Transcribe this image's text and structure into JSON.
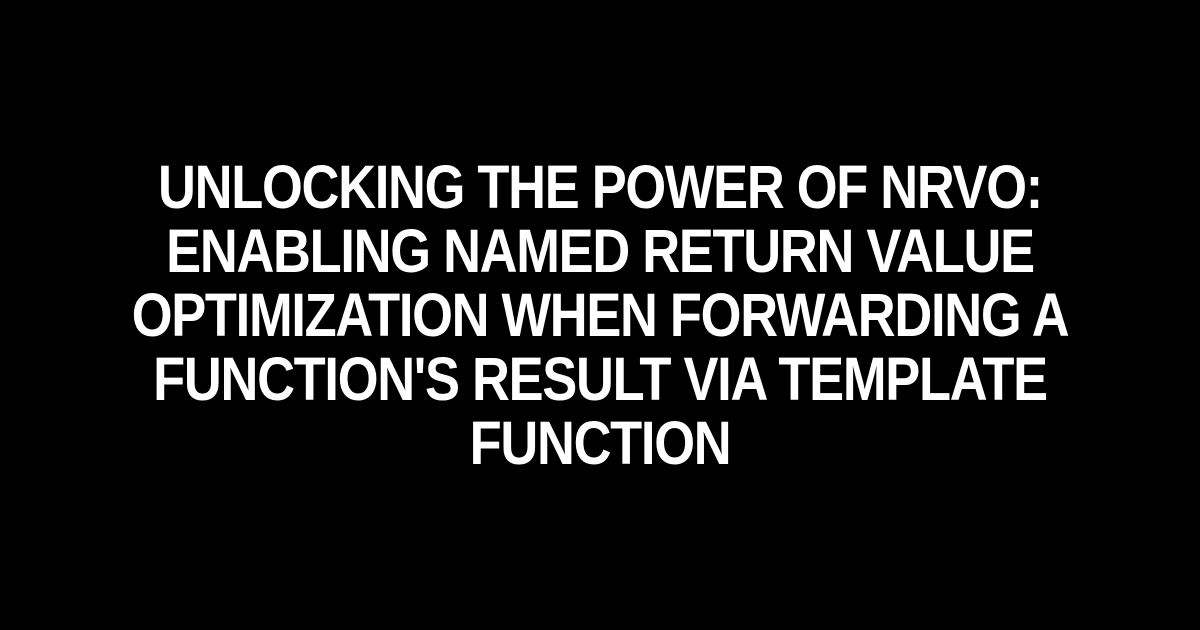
{
  "title": "Unlocking the Power of NRVO: Enabling Named Return Value Optimization when Forwarding a Function's Result via Template Function"
}
